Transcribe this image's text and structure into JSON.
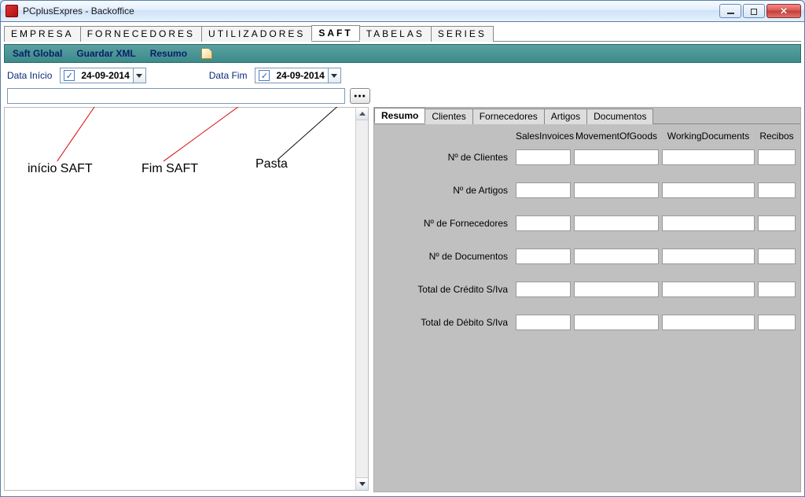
{
  "window": {
    "title": "PCplusExpres - Backoffice"
  },
  "mainTabs": {
    "items": [
      {
        "label": "EMPRESA",
        "active": false
      },
      {
        "label": "FORNECEDORES",
        "active": false
      },
      {
        "label": "UTILIZADORES",
        "active": false
      },
      {
        "label": "SAFT",
        "active": true
      },
      {
        "label": "TABELAS",
        "active": false
      },
      {
        "label": "SERIES",
        "active": false
      }
    ]
  },
  "toolbar": {
    "saftGlobal": "Saft Global",
    "guardarXml": "Guardar XML",
    "resumo": "Resumo"
  },
  "dates": {
    "startLabel": "Data Início",
    "startValue": "24-09-2014",
    "endLabel": "Data Fim",
    "endValue": "24-09-2014"
  },
  "path": {
    "value": "",
    "browseLabel": "●●●"
  },
  "annotations": {
    "inicio": "início SAFT",
    "fim": "Fim SAFT",
    "pasta": "Pasta"
  },
  "rightTabs": {
    "items": [
      {
        "label": "Resumo",
        "active": true
      },
      {
        "label": "Clientes",
        "active": false
      },
      {
        "label": "Fornecedores",
        "active": false
      },
      {
        "label": "Artigos",
        "active": false
      },
      {
        "label": "Documentos",
        "active": false
      }
    ]
  },
  "summary": {
    "columns": {
      "c1": "SalesInvoices",
      "c2": "MovementOfGoods",
      "c3": "WorkingDocuments",
      "c4": "Recibos"
    },
    "rows": {
      "clientes": "Nº de Clientes",
      "artigos": "Nº de Artigos",
      "fornecedores": "Nº de Fornecedores",
      "documentos": "Nº de Documentos",
      "creditoSiva": "Total de Crédito S/Iva",
      "debitoSiva": "Total de Débito S/Iva"
    }
  }
}
